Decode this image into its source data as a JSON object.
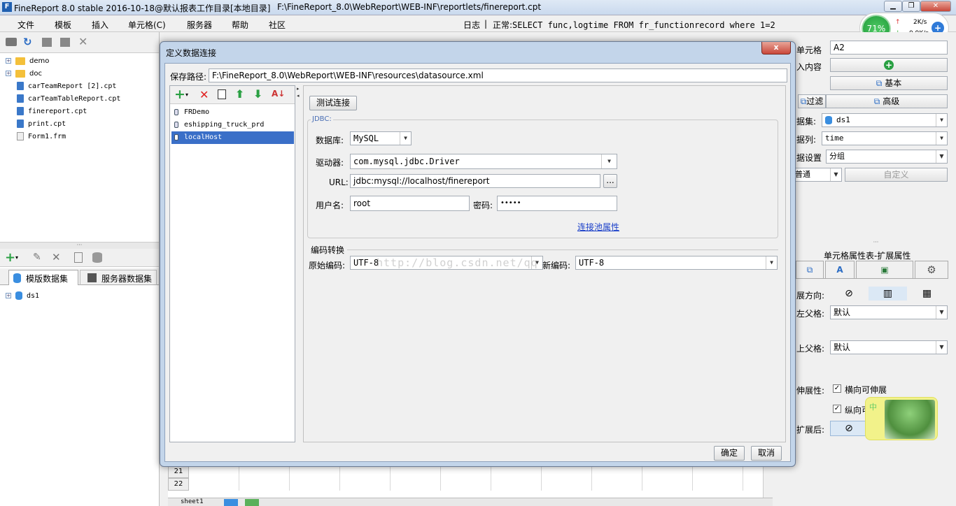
{
  "window": {
    "title": "FineReport 8.0 stable 2016-10-18@默认报表工作目录[本地目录]",
    "path": "F:\\FineReport_8.0\\WebReport\\WEB-INF\\reportlets/finereport.cpt"
  },
  "menu": [
    "文件",
    "模板",
    "插入",
    "单元格(C)",
    "服务器",
    "帮助",
    "社区"
  ],
  "log": {
    "label": "日志",
    "status": "正常:",
    "sql": "SELECT func,logtime FROM fr_functionrecord where 1=2"
  },
  "widget": {
    "percent": "71%",
    "up": "2K/s",
    "down": "0.9K/s"
  },
  "file_tree": [
    "demo",
    "doc",
    "carTeamReport [2].cpt",
    "carTeamTableReport.cpt",
    "finereport.cpt",
    "print.cpt",
    "Form1.frm"
  ],
  "dataset_tabs": [
    "模版数据集",
    "服务器数据集"
  ],
  "datasets": [
    "ds1"
  ],
  "right": {
    "cell_label": "单元格",
    "cell_value": "A2",
    "insert_label": "入内容",
    "basic": "基本",
    "filter": "过滤",
    "advanced": "高级",
    "dataset_label": "据集:",
    "dataset_value": "ds1",
    "column_label": "据列:",
    "column_value": "time",
    "setting_label": "据设置",
    "setting_value": "分组",
    "mode_value": "普通",
    "custom": "自定义",
    "section_title": "单元格属性表-扩展属性",
    "direction_label": "展方向:",
    "left_parent_label": "左父格:",
    "left_parent_value": "默认",
    "top_parent_label": "上父格:",
    "top_parent_value": "默认",
    "stretch_label": "伸展性:",
    "horizontal_stretch": "横向可伸展",
    "vertical_stretch": "纵向可",
    "after_expand_label": "扩展后:"
  },
  "grid": {
    "rows": [
      "21",
      "22"
    ],
    "sheet": "sheet1"
  },
  "dialog": {
    "title": "定义数据连接",
    "close": "x",
    "save_path_label": "保存路径:",
    "save_path": "F:\\FineReport_8.0\\WebReport\\WEB-INF\\resources\\datasource.xml",
    "connections": [
      "FRDemo",
      "eshipping_truck_prd",
      "localHost"
    ],
    "selected_connection": "localHost",
    "test_button": "测试连接",
    "jdbc_legend": "JDBC:",
    "db_label": "数据库:",
    "db_value": "MySQL",
    "driver_label": "驱动器:",
    "driver_value": "com.mysql.jdbc.Driver",
    "url_label": "URL:",
    "url_value": "jdbc:mysql://localhost/finereport",
    "url_more": "...",
    "user_label": "用户名:",
    "user_value": "root",
    "password_label": "密码:",
    "password_value": "•••••",
    "pool_link": "连接池属性",
    "encoding_legend": "编码转换",
    "orig_enc_label": "原始编码:",
    "orig_enc_value": "UTF-8",
    "new_enc_label": "新编码:",
    "new_enc_value": "UTF-8",
    "watermark": "http://blog.csdn.net/qq",
    "ok": "确定",
    "cancel": "取消"
  }
}
